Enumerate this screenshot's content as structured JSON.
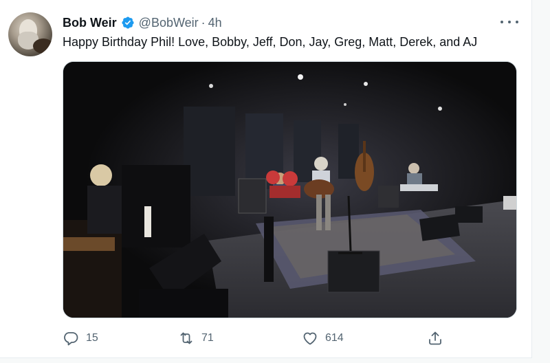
{
  "tweet": {
    "author_name": "Bob Weir",
    "author_handle": "@BobWeir",
    "separator": "·",
    "timestamp": "4h",
    "text": "Happy Birthday Phil! Love, Bobby, Jeff, Don, Jay, Greg, Matt, Derek, and AJ",
    "verified": true
  },
  "actions": {
    "reply_count": "15",
    "retweet_count": "71",
    "like_count": "614"
  },
  "colors": {
    "verified_badge": "#1d9bf0",
    "secondary_text": "#536471",
    "primary_text": "#0f1419"
  },
  "icons": {
    "reply": "reply-icon",
    "retweet": "retweet-icon",
    "like": "heart-icon",
    "share": "share-icon",
    "more": "more-icon",
    "verified": "verified-badge-icon"
  }
}
